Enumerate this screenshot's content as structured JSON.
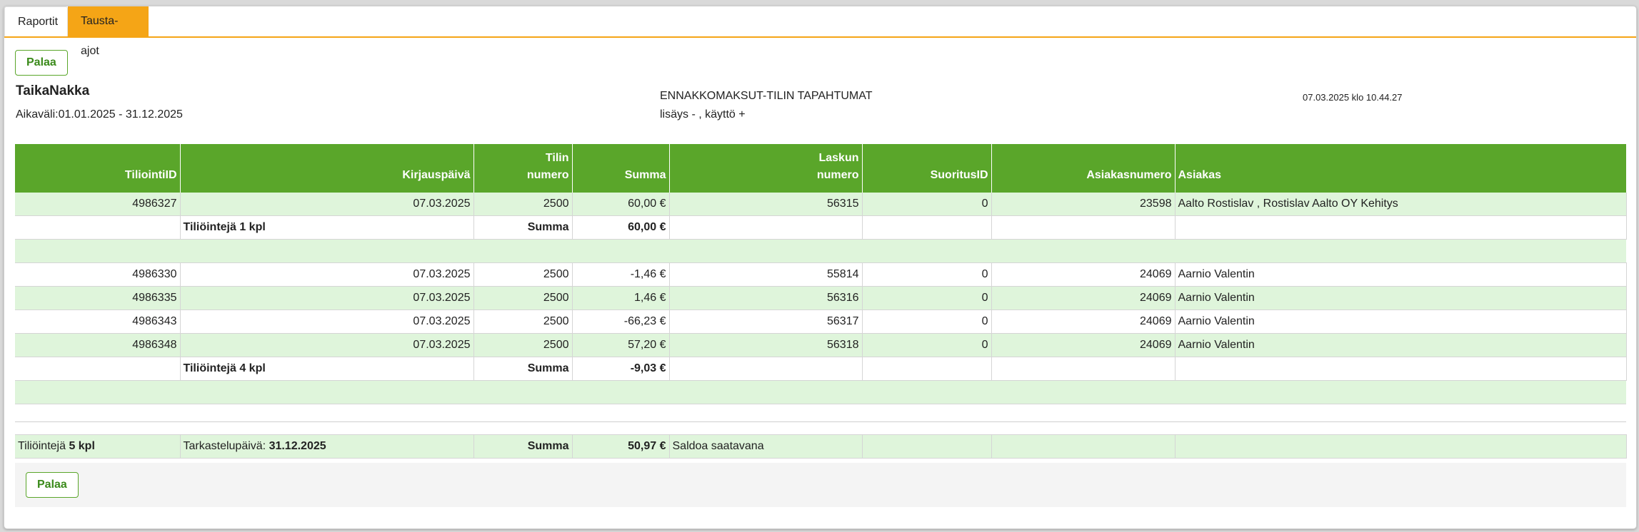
{
  "tabs": [
    {
      "label": "Raportit"
    },
    {
      "label": "Tausta-ajot"
    }
  ],
  "back_label": "Palaa",
  "report": {
    "company": "TaikaNakka",
    "range": "Aikaväli:01.01.2025 - 31.12.2025",
    "title": "ENNAKKOMAKSUT-TILIN TAPAHTUMAT",
    "subtitle": "lisäys - , käyttö +",
    "timestamp": "07.03.2025 klo 10.44.27"
  },
  "columns": {
    "c1": "TiliointiID",
    "c2": "Kirjauspäivä",
    "c3a": "Tilin",
    "c3b": "numero",
    "c4": "Summa",
    "c5a": "Laskun",
    "c5b": "numero",
    "c6": "SuoritusID",
    "c7": "Asiakasnumero",
    "c8": "Asiakas"
  },
  "group1": {
    "rows": [
      {
        "id": "4986327",
        "date": "07.03.2025",
        "account": "2500",
        "amount": "60,00 €",
        "invoice": "56315",
        "payment": "0",
        "custno": "23598",
        "customer": "Aalto Rostislav , Rostislav Aalto OY Kehitys"
      }
    ],
    "count": "Tiliöintejä 1 kpl",
    "sum_label": "Summa",
    "sum": "60,00 €"
  },
  "group2": {
    "rows": [
      {
        "id": "4986330",
        "date": "07.03.2025",
        "account": "2500",
        "amount": "-1,46 €",
        "invoice": "55814",
        "payment": "0",
        "custno": "24069",
        "customer": "Aarnio Valentin"
      },
      {
        "id": "4986335",
        "date": "07.03.2025",
        "account": "2500",
        "amount": "1,46 €",
        "invoice": "56316",
        "payment": "0",
        "custno": "24069",
        "customer": "Aarnio Valentin"
      },
      {
        "id": "4986343",
        "date": "07.03.2025",
        "account": "2500",
        "amount": "-66,23 €",
        "invoice": "56317",
        "payment": "0",
        "custno": "24069",
        "customer": "Aarnio Valentin"
      },
      {
        "id": "4986348",
        "date": "07.03.2025",
        "account": "2500",
        "amount": "57,20 €",
        "invoice": "56318",
        "payment": "0",
        "custno": "24069",
        "customer": "Aarnio Valentin"
      }
    ],
    "count": "Tiliöintejä 4 kpl",
    "sum_label": "Summa",
    "sum": "-9,03 €"
  },
  "total": {
    "count_prefix": "Tiliöintejä ",
    "count": "5 kpl",
    "date_prefix": "Tarkastelupäivä: ",
    "date": "31.12.2025",
    "sum_label": "Summa",
    "sum": "50,97 €",
    "note": "Saldoa saatavana"
  }
}
